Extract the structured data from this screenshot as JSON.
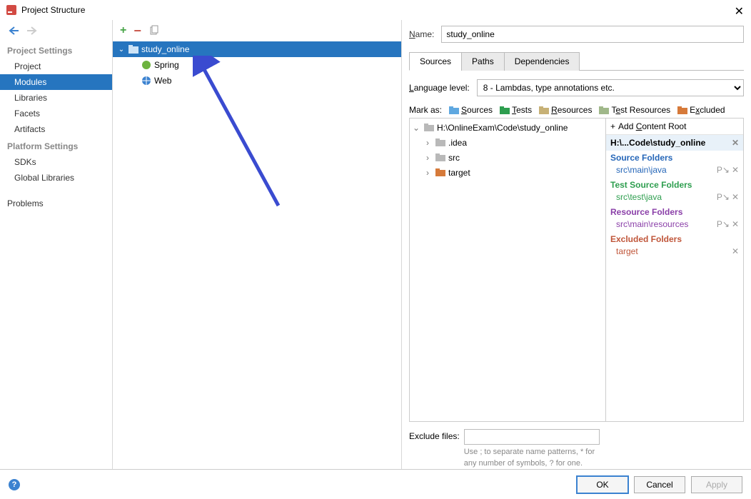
{
  "window": {
    "title": "Project Structure"
  },
  "sidebar": {
    "sections": [
      {
        "title": "Project Settings",
        "items": [
          "Project",
          "Modules",
          "Libraries",
          "Facets",
          "Artifacts"
        ],
        "selected": 1
      },
      {
        "title": "Platform Settings",
        "items": [
          "SDKs",
          "Global Libraries"
        ]
      },
      {
        "title": "",
        "items": [
          "Problems"
        ]
      }
    ]
  },
  "module_tree": {
    "root": {
      "label": "study_online",
      "selected": true
    },
    "children": [
      {
        "label": "Spring",
        "icon": "spring"
      },
      {
        "label": "Web",
        "icon": "web"
      }
    ]
  },
  "right": {
    "name_label": "Name:",
    "name_value": "study_online",
    "tabs": [
      "Sources",
      "Paths",
      "Dependencies"
    ],
    "active_tab": 0,
    "lang_label": "Language level:",
    "lang_value": "8 - Lambdas, type annotations etc.",
    "markas_label": "Mark as:",
    "markas": [
      {
        "label": "Sources",
        "color": "#3b82d0"
      },
      {
        "label": "Tests",
        "color": "#2e9e4f"
      },
      {
        "label": "Resources",
        "color": "#c0a050"
      },
      {
        "label": "Test Resources",
        "color": "#8aa06a"
      },
      {
        "label": "Excluded",
        "color": "#d67a3a"
      }
    ],
    "file_tree": {
      "root": "H:\\OnlineExam\\Code\\study_online",
      "children": [
        {
          "label": ".idea",
          "color": "#999"
        },
        {
          "label": "src",
          "color": "#999"
        },
        {
          "label": "target",
          "color": "#d67a3a"
        }
      ]
    },
    "content_root": {
      "add_label": "Add Content Root",
      "path": "H:\\...Code\\study_online",
      "sections": [
        {
          "title": "Source Folders",
          "color": "#2566b8",
          "items": [
            "src\\main\\java"
          ]
        },
        {
          "title": "Test Source Folders",
          "color": "#2e9e4f",
          "items": [
            "src\\test\\java"
          ]
        },
        {
          "title": "Resource Folders",
          "color": "#8a3fa8",
          "items": [
            "src\\main\\resources"
          ]
        },
        {
          "title": "Excluded Folders",
          "color": "#c0563a",
          "items": [
            "target"
          ]
        }
      ]
    },
    "exclude_label": "Exclude files:",
    "exclude_hint": "Use ; to separate name patterns, * for any number of symbols, ? for one."
  },
  "buttons": {
    "ok": "OK",
    "cancel": "Cancel",
    "apply": "Apply"
  }
}
